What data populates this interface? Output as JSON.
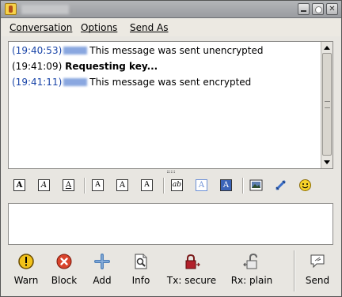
{
  "menu": [
    "Conversation",
    "Options",
    "Send As"
  ],
  "log": [
    {
      "time": "(19:40:53)",
      "message": "This message was sent unencrypted"
    },
    {
      "time": "(19:41:09)",
      "message": "Requesting key..."
    },
    {
      "time": "(19:41:11)",
      "message": "This message was sent encrypted"
    }
  ],
  "format_buttons": [
    "A",
    "A",
    "A",
    "A",
    "A",
    "A",
    "ab",
    "A",
    "A"
  ],
  "actions": {
    "warn": "Warn",
    "block": "Block",
    "add": "Add",
    "info": "Info",
    "tx": "Tx: secure",
    "rx": "Rx: plain",
    "send": "Send"
  },
  "colors": {
    "timestamp_blue": "#1a45a8",
    "warn_yellow": "#f2c21a",
    "block_red": "#d9432b",
    "lock_red": "#b2202a",
    "add_blue": "#4d7fb8"
  }
}
